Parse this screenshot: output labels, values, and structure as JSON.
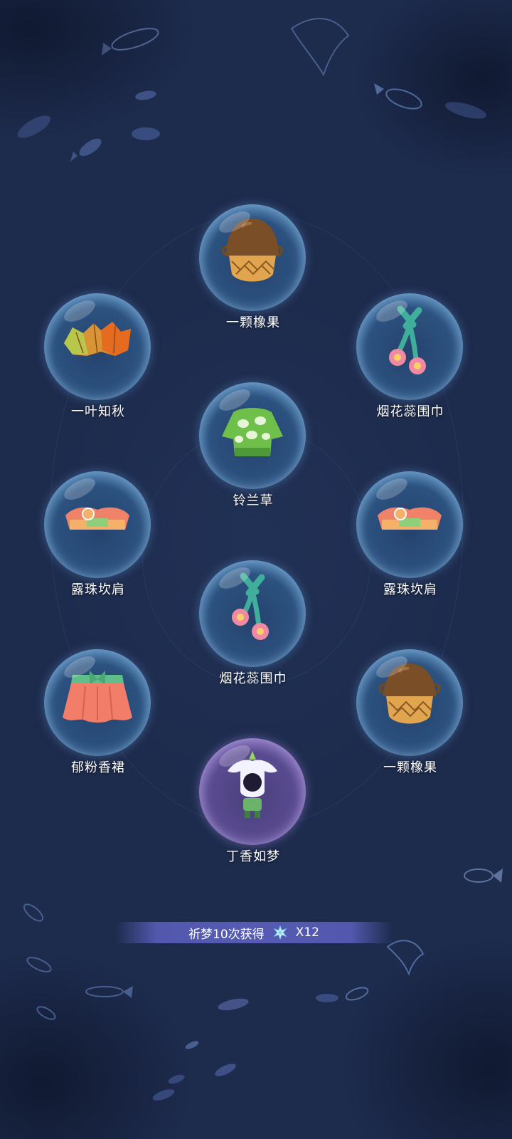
{
  "items": [
    {
      "name": "一颗橡果",
      "icon": "acorn-icon"
    },
    {
      "name": "一叶知秋",
      "icon": "autumn-leaf-top-icon"
    },
    {
      "name": "烟花蕊围巾",
      "icon": "flower-scarf-icon"
    },
    {
      "name": "铃兰草",
      "icon": "lily-of-valley-top-icon"
    },
    {
      "name": "露珠坎肩",
      "icon": "dewdrop-vest-icon"
    },
    {
      "name": "露珠坎肩",
      "icon": "dewdrop-vest-icon"
    },
    {
      "name": "烟花蕊围巾",
      "icon": "flower-scarf-icon"
    },
    {
      "name": "郁粉香裙",
      "icon": "pink-skirt-icon"
    },
    {
      "name": "一颗橡果",
      "icon": "acorn-icon"
    },
    {
      "name": "丁香如梦",
      "icon": "lilac-dream-outfit-icon"
    }
  ],
  "reward_banner": {
    "text": "祈梦10次获得",
    "currency_icon": "star-crystal-icon",
    "count": "X12"
  },
  "colors": {
    "background": "#1d2b4d",
    "bubble_blue": "#5a8fc0",
    "bubble_purple": "#8a76c2",
    "banner": "#5c60be"
  }
}
